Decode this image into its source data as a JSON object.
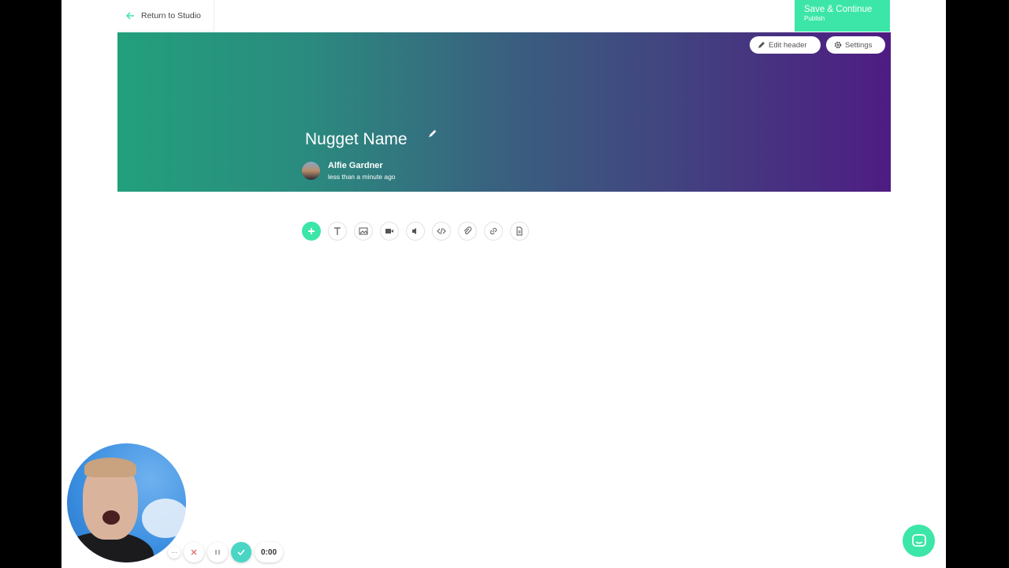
{
  "topbar": {
    "return_label": "Return to Studio"
  },
  "save": {
    "main_label": "Save & Continue",
    "sub_label": "Publish"
  },
  "header": {
    "edit_label": "Edit header",
    "settings_label": "Settings",
    "title": "Nugget Name",
    "author": "Alfie Gardner",
    "time": "less than a minute ago",
    "gradient_start": "#22a07c",
    "gradient_end": "#4e1c82"
  },
  "toolbar": {
    "items": [
      "add-icon",
      "text-icon",
      "image-icon",
      "video-icon",
      "audio-icon",
      "code-icon",
      "attachment-icon",
      "link-icon",
      "document-icon"
    ]
  },
  "recorder": {
    "timer": "0:00"
  },
  "colors": {
    "accent": "#3ce6a8",
    "record_done": "#49d6c4",
    "cancel": "#e57373"
  }
}
